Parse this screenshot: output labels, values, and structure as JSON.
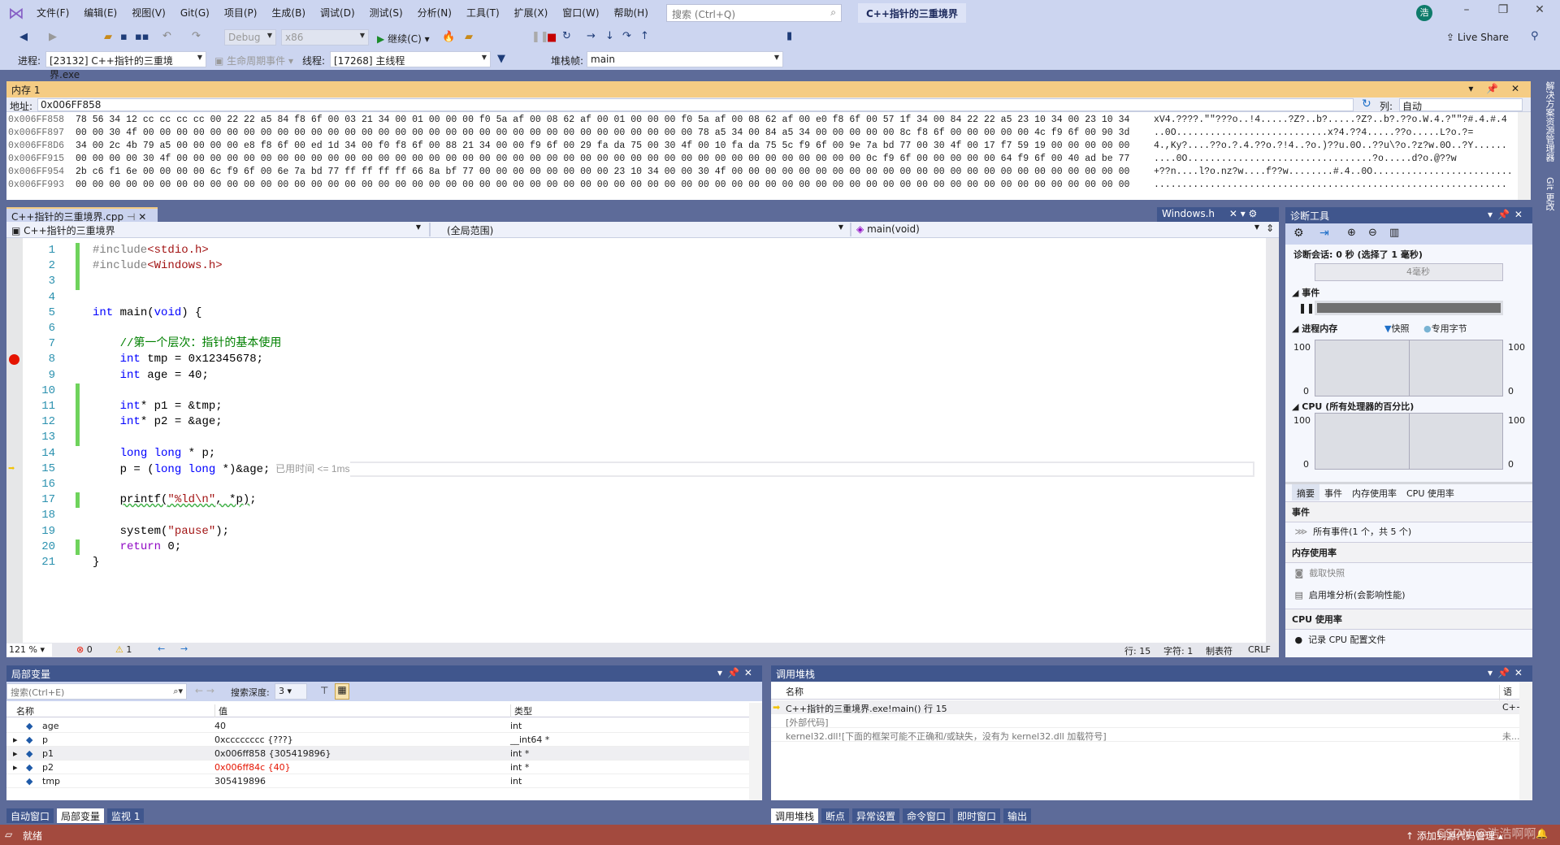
{
  "title": {
    "menu": [
      "文件(F)",
      "编辑(E)",
      "视图(V)",
      "Git(G)",
      "项目(P)",
      "生成(B)",
      "调试(D)",
      "测试(S)",
      "分析(N)",
      "工具(T)",
      "扩展(X)",
      "窗口(W)",
      "帮助(H)"
    ],
    "search_placeholder": "搜索 (Ctrl+Q)",
    "solution": "C++指针的三重境界",
    "avatar": "浩"
  },
  "toolbar": {
    "config": "Debug",
    "platform": "x86",
    "continue": "继续(C)",
    "live_share": "Live Share"
  },
  "debugbar": {
    "process_label": "进程:",
    "process": "[23132] C++指针的三重境界.exe",
    "lifecycle": "生命周期事件",
    "thread_label": "线程:",
    "thread": "[17268] 主线程",
    "stack_label": "堆栈帧:",
    "stack": "main"
  },
  "memory": {
    "title": "内存 1",
    "address_label": "地址:",
    "address": "0x006FF858",
    "col_label": "列:",
    "col": "自动",
    "rows": [
      {
        "addr": "0x006FF858",
        "hex": "78 56 34 12 cc cc cc cc 00 22 22 a5 84 f8 6f 00 03 21 34 00 01 00 00 00 f0 5a af 00 08 62 af 00 01 00 00 00 f0 5a af 00 08 62 af 00 e0 f8 6f 00 57 1f 34 00 84 22 22 a5 23 10 34 00 23 10 34",
        "ascii": "xV4.????.\"\"???o..!4.....?Z?..b?.....?Z?..b?.??o.W.4.?\"\"?#.4.#.4"
      },
      {
        "addr": "0x006FF897",
        "hex": "00 00 30 4f 00 00 00 00 00 00 00 00 00 00 00 00 00 00 00 00 00 00 00 00 00 00 00 00 00 00 00 00 00 00 00 00 00 78 a5 34 00 84 a5 34 00 00 00 00 00 8c f8 6f 00 00 00 00 00 4c f9 6f 00 90 3d",
        "ascii": "..0O...........................x?4.??4.....??o.....L?o.?="
      },
      {
        "addr": "0x006FF8D6",
        "hex": "34 00 2c 4b 79 a5 00 00 00 00 e8 f8 6f 00 ed 1d 34 00 f0 f8 6f 00 88 21 34 00 00 f9 6f 00 29 fa da 75 00 30 4f 00 10 fa da 75 5c f9 6f 00 9e 7a bd 77 00 30 4f 00 17 f7 59 19 00 00 00 00 00",
        "ascii": "4.,Ky?....??o.?.4.??o.?!4..?o.)??u.0O..??u\\?o.?z?w.0O..?Y......"
      },
      {
        "addr": "0x006FF915",
        "hex": "00 00 00 00 30 4f 00 00 00 00 00 00 00 00 00 00 00 00 00 00 00 00 00 00 00 00 00 00 00 00 00 00 00 00 00 00 00 00 00 00 00 00 00 00 00 00 00 0c f9 6f 00 00 00 00 00 64 f9 6f 00 40 ad be 77",
        "ascii": "....0O.................................?o.....d?o.@??w"
      },
      {
        "addr": "0x006FF954",
        "hex": "2b c6 f1 6e 00 00 00 00 6c f9 6f 00 6e 7a bd 77 ff ff ff ff 66 8a bf 77 00 00 00 00 00 00 00 00 23 10 34 00 00 30 4f 00 00 00 00 00 00 00 00 00 00 00 00 00 00 00 00 00 00 00 00 00 00 00 00",
        "ascii": "+??n....l?o.nz?w....f??w........#.4..0O........................."
      },
      {
        "addr": "0x006FF993",
        "hex": "00 00 00 00 00 00 00 00 00 00 00 00 00 00 00 00 00 00 00 00 00 00 00 00 00 00 00 00 00 00 00 00 00 00 00 00 00 00 00 00 00 00 00 00 00 00 00 00 00 00 00 00 00 00 00 00 00 00 00 00 00 00 00",
        "ascii": "..............................................................."
      }
    ]
  },
  "editor": {
    "tab": "C++指针的三重境界.cpp",
    "tab2": "Windows.h",
    "nav_project": "C++指针的三重境界",
    "nav_scope": "(全局范围)",
    "nav_func": "main(void)",
    "lines": [
      {
        "n": "1",
        "changed": true,
        "t": [
          [
            "#include",
            "pp"
          ],
          [
            "<stdio.h>",
            "str"
          ]
        ]
      },
      {
        "n": "2",
        "changed": true,
        "t": [
          [
            "#include",
            "pp"
          ],
          [
            "<Windows.h>",
            "str"
          ]
        ]
      },
      {
        "n": "3",
        "changed": true,
        "t": []
      },
      {
        "n": "4",
        "t": []
      },
      {
        "n": "5",
        "t": [
          [
            "int",
            "kw"
          ],
          [
            " main(",
            "pl"
          ],
          [
            "void",
            "kw"
          ],
          [
            ") {",
            "pl"
          ]
        ]
      },
      {
        "n": "6",
        "t": []
      },
      {
        "n": "7",
        "t": [
          [
            "    //第一个层次：指针的基本使用",
            "cmt"
          ]
        ]
      },
      {
        "n": "8",
        "breakpoint": true,
        "t": [
          [
            "    ",
            "pl"
          ],
          [
            "int",
            "kw"
          ],
          [
            " tmp = 0x12345678;",
            "pl"
          ]
        ]
      },
      {
        "n": "9",
        "t": [
          [
            "    ",
            "pl"
          ],
          [
            "int",
            "kw"
          ],
          [
            " age = 40;",
            "pl"
          ]
        ]
      },
      {
        "n": "10",
        "changed": true,
        "t": []
      },
      {
        "n": "11",
        "changed": true,
        "t": [
          [
            "    ",
            "pl"
          ],
          [
            "int",
            "kw"
          ],
          [
            "* p1 = &tmp;",
            "pl"
          ]
        ]
      },
      {
        "n": "12",
        "changed": true,
        "t": [
          [
            "    ",
            "pl"
          ],
          [
            "int",
            "kw"
          ],
          [
            "* p2 = &age;",
            "pl"
          ]
        ]
      },
      {
        "n": "13",
        "changed": true,
        "t": []
      },
      {
        "n": "14",
        "t": [
          [
            "    ",
            "pl"
          ],
          [
            "long long",
            "kw"
          ],
          [
            " * p;",
            "pl"
          ]
        ]
      },
      {
        "n": "15",
        "current": true,
        "t": [
          [
            "    p = (",
            "pl"
          ],
          [
            "long long",
            "kw"
          ],
          [
            " *)&age;",
            "pl"
          ],
          [
            "  已用时间 <= 1ms",
            "hint"
          ]
        ]
      },
      {
        "n": "16",
        "t": []
      },
      {
        "n": "17",
        "changed": true,
        "t": [
          [
            "    ",
            "pl"
          ],
          [
            "printf(",
            "pl squig"
          ],
          [
            "\"%ld\\n\"",
            "str squig"
          ],
          [
            ", *p)",
            "pl squig"
          ],
          [
            ";",
            "pl"
          ]
        ]
      },
      {
        "n": "18",
        "t": []
      },
      {
        "n": "19",
        "t": [
          [
            "    system(",
            "pl"
          ],
          [
            "\"pause\"",
            "str"
          ],
          [
            ");",
            "pl"
          ]
        ]
      },
      {
        "n": "20",
        "changed": true,
        "t": [
          [
            "    ",
            "pl"
          ],
          [
            "return",
            "kw2"
          ],
          [
            " 0;",
            "pl"
          ]
        ]
      },
      {
        "n": "21",
        "t": [
          [
            "}",
            "pl"
          ]
        ]
      }
    ],
    "status": {
      "zoom": "121 %",
      "errors": "0",
      "warnings": "1",
      "line": "行: 15",
      "char": "字符: 1",
      "tabs": "制表符",
      "eol": "CRLF"
    }
  },
  "diag": {
    "title": "诊断工具",
    "session": "诊断会话: 0 秒 (选择了 1 毫秒)",
    "ruler": "4毫秒",
    "events": "事件",
    "memory": "进程内存",
    "legend_snapshot": "快照",
    "legend_private": "专用字节",
    "cpu": "CPU (所有处理器的百分比)",
    "y_max": "100",
    "y_min": "0",
    "tabs": [
      "摘要",
      "事件",
      "内存使用率",
      "CPU 使用率"
    ],
    "sum_events": "事件",
    "all_events": "所有事件(1 个，共 5 个)",
    "sum_mem": "内存使用率",
    "snapshot": "截取快照",
    "heap": "启用堆分析(会影响性能)",
    "sum_cpu": "CPU 使用率",
    "cpu_profile": "记录 CPU 配置文件"
  },
  "locals": {
    "title": "局部变量",
    "search_placeholder": "搜索(Ctrl+E)",
    "depth_label": "搜索深度:",
    "depth": "3",
    "cols": [
      "名称",
      "值",
      "类型"
    ],
    "rows": [
      {
        "name": "age",
        "value": "40",
        "type": "int",
        "expand": false
      },
      {
        "name": "p",
        "value": "0xcccccccc {???}",
        "type": "__int64 *",
        "expand": true
      },
      {
        "name": "p1",
        "value": "0x006ff858 {305419896}",
        "type": "int *",
        "expand": true,
        "selected": true
      },
      {
        "name": "p2",
        "value": "0x006ff84c {40}",
        "type": "int *",
        "expand": true,
        "changed": true
      },
      {
        "name": "tmp",
        "value": "305419896",
        "type": "int",
        "expand": false
      }
    ],
    "tabs": [
      "自动窗口",
      "局部变量",
      "监视 1"
    ]
  },
  "callstack": {
    "title": "调用堆栈",
    "cols": [
      "名称",
      "语言"
    ],
    "rows": [
      {
        "name": "C++指针的三重境界.exe!main() 行 15",
        "lang": "C++",
        "current": true
      },
      {
        "name": "[外部代码]",
        "lang": ""
      },
      {
        "name": "kernel32.dll![下面的框架可能不正确和/或缺失，没有为 kernel32.dll 加载符号]",
        "lang": "未..."
      }
    ],
    "tabs": [
      "调用堆栈",
      "断点",
      "异常设置",
      "命令窗口",
      "即时窗口",
      "输出"
    ]
  },
  "side_tabs": [
    "解决方案资源管理器",
    "Git 更改"
  ],
  "statusbar": {
    "ready": "就绪",
    "source_control": "添加到源代码管理",
    "watermark": "CSDN @浩浩啊啊"
  },
  "colors": {
    "status_bar": "#a34a3e",
    "memory_header": "#f5cc84",
    "tool_header": "#40568d",
    "changed_value": "#e51400"
  }
}
